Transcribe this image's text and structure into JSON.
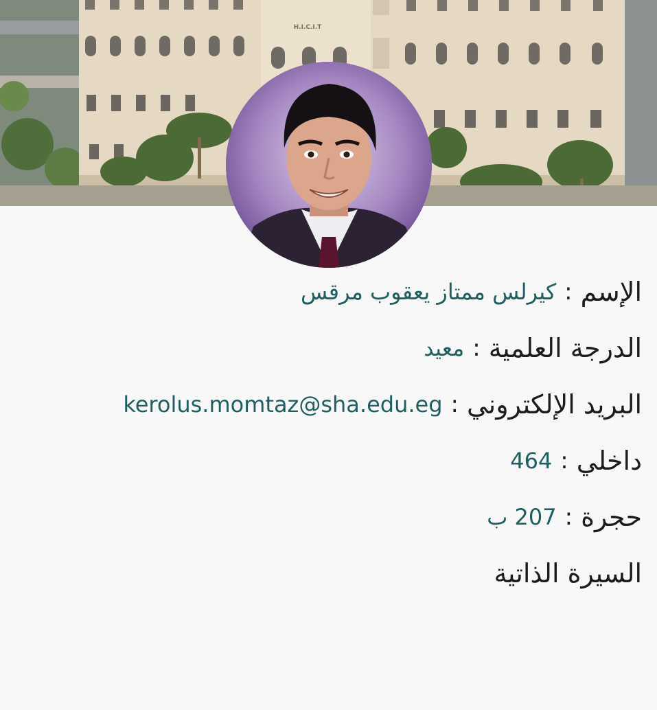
{
  "banner": {
    "building_sign": "H.I.C.I.T"
  },
  "profile": {
    "fields": [
      {
        "label": "الإسم",
        "separator": ":",
        "value": "كيرلس ممتاز يعقوب مرقس"
      },
      {
        "label": "الدرجة العلمية",
        "separator": ":",
        "value": "معيد"
      },
      {
        "label": "البريد الإلكتروني",
        "separator": ":",
        "value": "kerolus.momtaz@sha.edu.eg"
      },
      {
        "label": "داخلي",
        "separator": ":",
        "value": "464"
      },
      {
        "label": "حجرة",
        "separator": ":",
        "value": "207 ب"
      }
    ],
    "cv_link": "السيرة الذاتية"
  },
  "colors": {
    "label": "#1c1c1c",
    "value": "#1f5f62",
    "background": "#f8f8f8"
  }
}
